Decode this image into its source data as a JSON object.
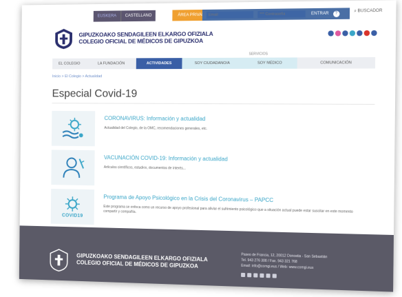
{
  "topbar": {
    "lang_eus": "EUSKERA",
    "lang_cas": "CASTELLANO",
    "private_area": "ÁREA PRIVADA",
    "email_placeholder": "Email",
    "password_placeholder": "*** Contraseña",
    "enter_label": "ENTRAR",
    "search_label": "BUSCADOR"
  },
  "header": {
    "org_line1": "GIPUZKOAKO SENDAGILEEN ELKARGO OFIZIALA",
    "org_line2": "COLEGIO OFICIAL DE MÉDICOS DE GIPUZKOA",
    "social_icons": [
      "instagram-icon",
      "flickr-icon",
      "facebook-icon",
      "twitter-icon",
      "linkedin-icon",
      "youtube-icon",
      "whatsapp-icon"
    ],
    "social_colors": [
      "#3a5fa6",
      "#e05aa0",
      "#3a5fa6",
      "#3aa6c8",
      "#3a5fa6",
      "#d9342b",
      "#3a5fa6"
    ]
  },
  "nav": {
    "services_label": "SERVICIOS",
    "items": [
      "EL COLEGIO",
      "LA FUNDACIÓN",
      "ACTIVIDADES",
      "SOY CIUDADANO/A",
      "SOY MÉDICO",
      "COMUNICACIÓN"
    ]
  },
  "breadcrumb": "Inicio > El Colegio > Actualidad",
  "page_title": "Especial Covid-19",
  "items": [
    {
      "title": "CORONAVIRUS: Información y actualidad",
      "desc": "Actualidad del Colegio, de la OMC, recomendaciones generales, etc.",
      "icon": "virus-icon"
    },
    {
      "title": "VACUNACIÓN COVID-19: Información y actualidad",
      "desc": "Artículos científicos, estudios, documentos de interés...",
      "icon": "doctor-icon"
    },
    {
      "title": "Programa de Apoyo Psicológico en la Crisis del Coronavirus – PAPCC",
      "desc": "Este programa se enfoca como un recurso de apoyo profesional para aliviar el sufrimiento psicológico que a situación actual puede estar suscitar en este momento compartir y compañía.",
      "icon": "covid19-icon",
      "label": "COVID19"
    }
  ],
  "footer": {
    "org_line1": "GIPUZKOAKO SENDAGILEEN ELKARGO OFIZIALA",
    "org_line2": "COLEGIO OFICIAL DE MÉDICOS DE GIPUZKOA",
    "address": "Paseo de Francia, 12, 20012 Donostia - San Sebastián",
    "phone": "Tel. 943 276 300 / Fax. 943 321 768",
    "email": "Email: info@comgi.eus / Web: www.comgi.eus"
  }
}
